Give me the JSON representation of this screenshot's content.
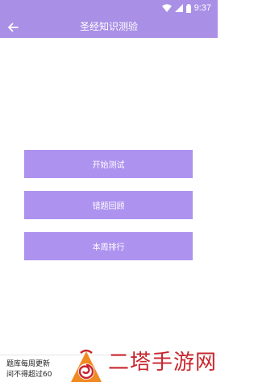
{
  "status_bar": {
    "time": "9:37",
    "icons": [
      "wifi-icon",
      "signal-icon",
      "battery-icon"
    ]
  },
  "app_bar": {
    "title": "圣经知识测验",
    "back_icon": "arrow-left-icon"
  },
  "menu": [
    {
      "label": "开始测试"
    },
    {
      "label": "错题回顾"
    },
    {
      "label": "本周排行"
    }
  ],
  "notice": {
    "line1": "题库每周更新",
    "line2": "间不得超过60"
  },
  "watermark": {
    "text": "二塔手游网",
    "logo_icon": "spiral-logo-icon"
  },
  "colors": {
    "primary": "#a98fe6",
    "button": "#ad92ef",
    "watermark": "#c8252d"
  }
}
